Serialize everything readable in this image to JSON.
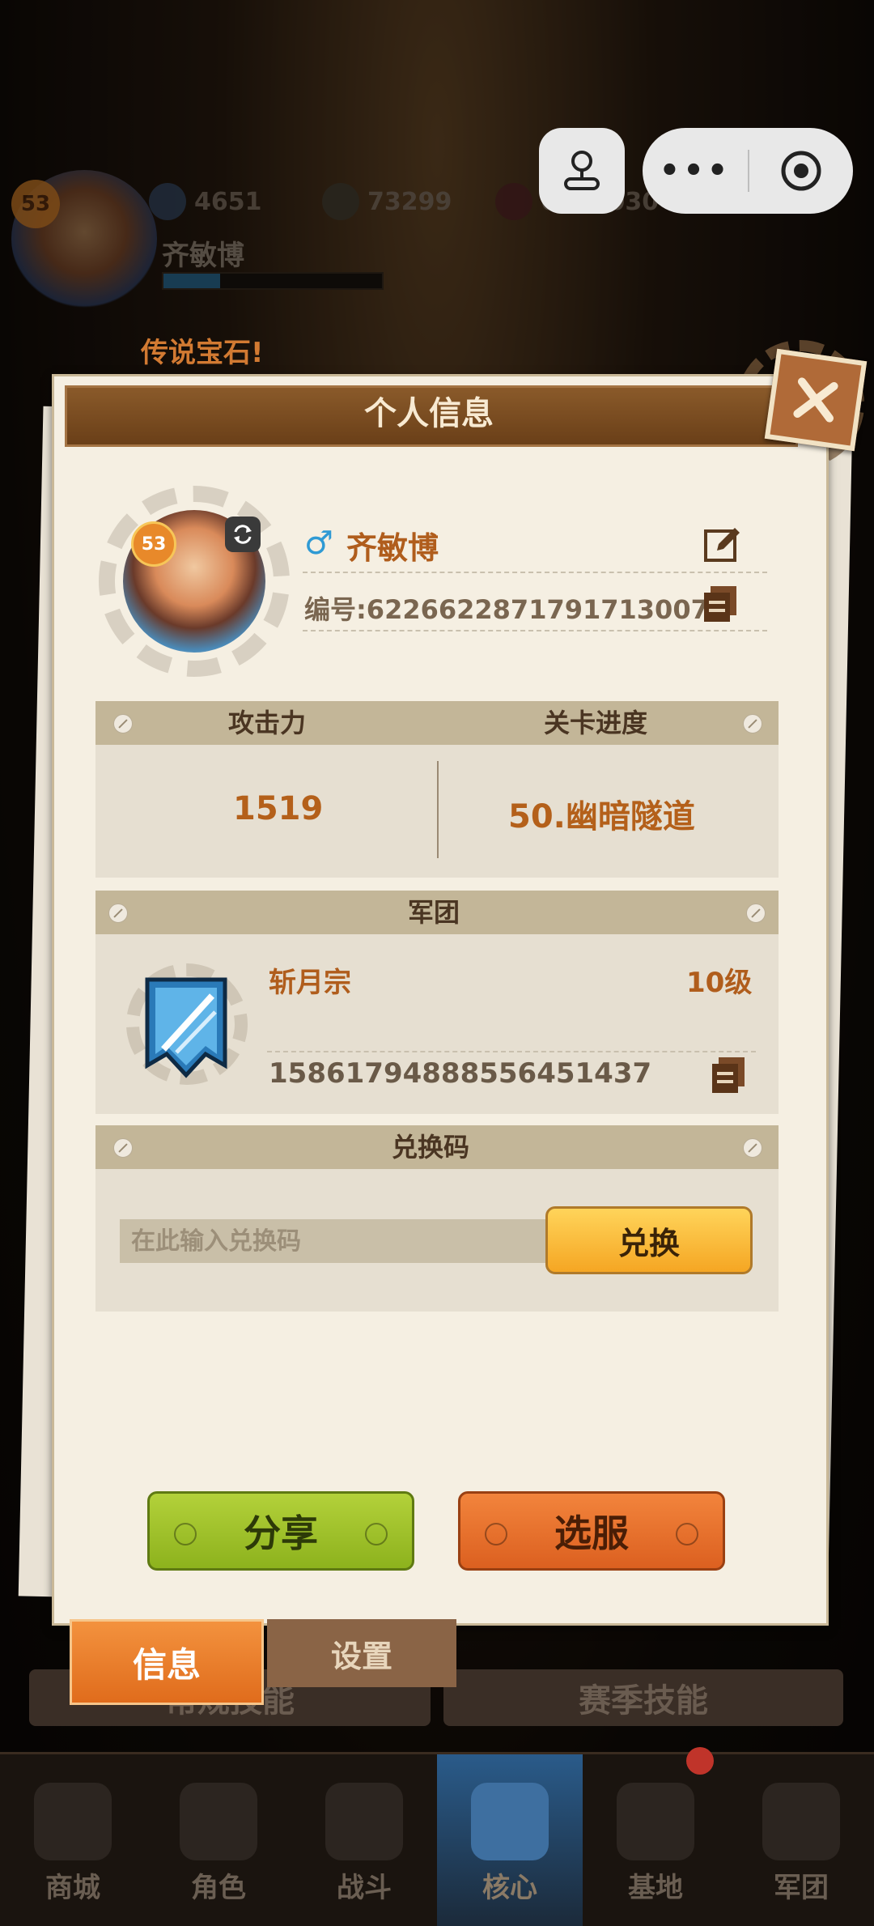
{
  "hud": {
    "level": "53",
    "resources": [
      "4651",
      "73299",
      "6160030"
    ],
    "player_name": "齐敏博",
    "exp_fraction": 0.26,
    "ticker": "传说宝石!"
  },
  "modal": {
    "title": "个人信息",
    "profile": {
      "level": "53",
      "gender_symbol": "♂",
      "name": "齐敏博",
      "id_text": "编号:6226622871791713007"
    },
    "stats": {
      "attack_label": "攻击力",
      "attack_value": "1519",
      "progress_label": "关卡进度",
      "progress_value": "50.幽暗隧道"
    },
    "legion": {
      "header": "军团",
      "name": "斩月宗",
      "level": "10级",
      "id": "15861794888556451437"
    },
    "redeem": {
      "header": "兑换码",
      "placeholder": "在此输入兑换码",
      "button": "兑换"
    },
    "buttons": {
      "share": "分享",
      "server": "选服"
    }
  },
  "tabs": {
    "info": "信息",
    "settings": "设置"
  },
  "skills": {
    "normal": "常规技能",
    "season": "赛季技能"
  },
  "bottom_nav": [
    "商城",
    "角色",
    "战斗",
    "核心",
    "基地",
    "军团"
  ],
  "active_nav": "核心",
  "colors": {
    "accent_orange": "#b05d1c",
    "header_brown": "#6a3f18",
    "share_green": "#8db21d",
    "server_orange": "#dc6020",
    "redeem_yellow": "#f5a623"
  }
}
